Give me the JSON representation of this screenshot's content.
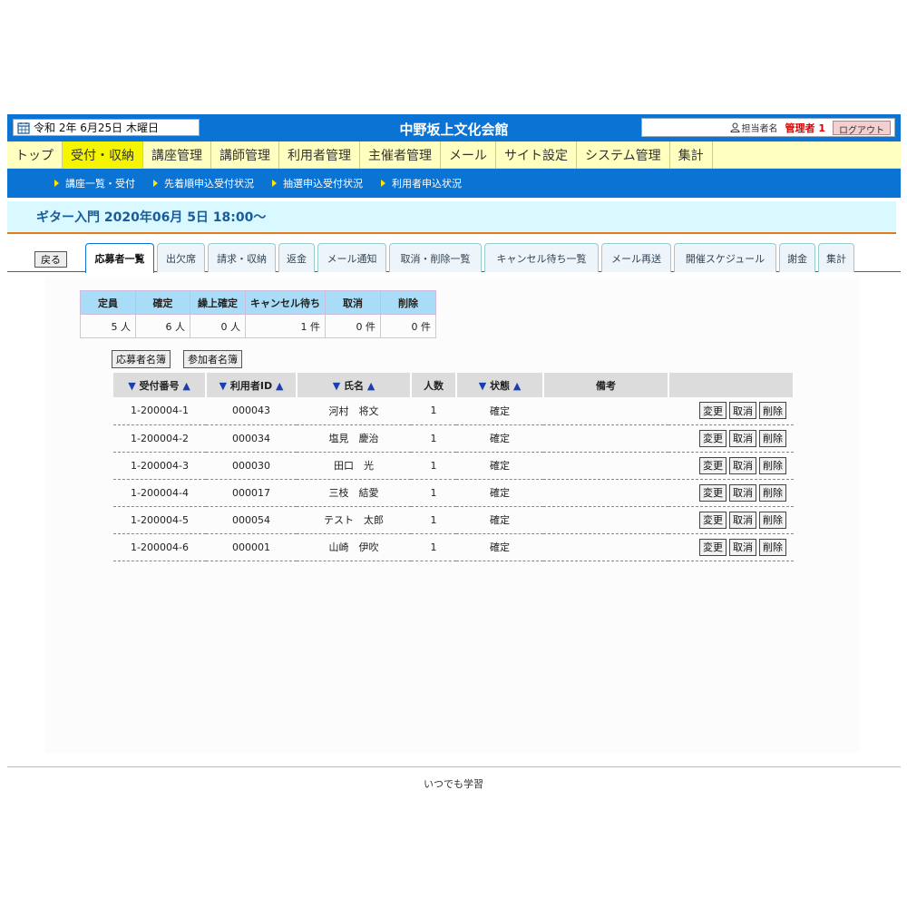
{
  "header": {
    "date": "令和 2年 6月25日 木曜日",
    "site_title": "中野坂上文化会館",
    "role_label": "担当者名",
    "user": "管理者 1",
    "logout_label": "ログアウト"
  },
  "main_nav": [
    {
      "label": "トップ",
      "active": false
    },
    {
      "label": "受付・収納",
      "active": true
    },
    {
      "label": "講座管理",
      "active": false
    },
    {
      "label": "講師管理",
      "active": false
    },
    {
      "label": "利用者管理",
      "active": false
    },
    {
      "label": "主催者管理",
      "active": false
    },
    {
      "label": "メール",
      "active": false
    },
    {
      "label": "サイト設定",
      "active": false
    },
    {
      "label": "システム管理",
      "active": false
    },
    {
      "label": "集計",
      "active": false
    }
  ],
  "sub_nav": [
    "講座一覧・受付",
    "先着順申込受付状況",
    "抽選申込受付状況",
    "利用者申込状況"
  ],
  "course_title": "ギター入門 2020年06月 5日 18:00～",
  "tabs": {
    "back_label": "戻る",
    "items": [
      "応募者一覧",
      "出欠席",
      "請求・収納",
      "返金",
      "メール通知",
      "取消・削除一覧",
      "キャンセル待ち一覧",
      "メール再送",
      "開催スケジュール",
      "謝金",
      "集計"
    ],
    "active": 0
  },
  "summary": {
    "headers": [
      "定員",
      "確定",
      "繰上確定",
      "キャンセル待ち",
      "取消",
      "削除"
    ],
    "values": [
      "5 人",
      "6 人",
      "0 人",
      "1 件",
      "0 件",
      "0 件"
    ]
  },
  "list_buttons": {
    "applicants_list": "応募者名簿",
    "participants_list": "参加者名簿"
  },
  "applicants": {
    "sort_desc": "▼",
    "sort_asc": "▲",
    "headers": {
      "receipt_no": "受付番号",
      "user_id": "利用者ID",
      "name": "氏名",
      "count": "人数",
      "status": "状態",
      "note": "備考"
    },
    "rows": [
      {
        "receipt_no": "1-200004-1",
        "user_id": "000043",
        "name": "河村　将文",
        "count": "1",
        "status": "確定",
        "note": ""
      },
      {
        "receipt_no": "1-200004-2",
        "user_id": "000034",
        "name": "塩見　慶治",
        "count": "1",
        "status": "確定",
        "note": ""
      },
      {
        "receipt_no": "1-200004-3",
        "user_id": "000030",
        "name": "田口　光",
        "count": "1",
        "status": "確定",
        "note": ""
      },
      {
        "receipt_no": "1-200004-4",
        "user_id": "000017",
        "name": "三枝　結愛",
        "count": "1",
        "status": "確定",
        "note": ""
      },
      {
        "receipt_no": "1-200004-5",
        "user_id": "000054",
        "name": "テスト　太郎",
        "count": "1",
        "status": "確定",
        "note": ""
      },
      {
        "receipt_no": "1-200004-6",
        "user_id": "000001",
        "name": "山崎　伊吹",
        "count": "1",
        "status": "確定",
        "note": ""
      }
    ],
    "action_labels": {
      "edit": "変更",
      "cancel": "取消",
      "delete": "削除"
    }
  },
  "footer": "いつでも学習",
  "colors": {
    "header_blue": "#0b73d4",
    "nav_yellow": "#ffffbf",
    "nav_active": "#f5f500",
    "course_bg": "#d9f8ff",
    "accent_orange": "#e07a1a",
    "admin_red": "#dd0000"
  }
}
